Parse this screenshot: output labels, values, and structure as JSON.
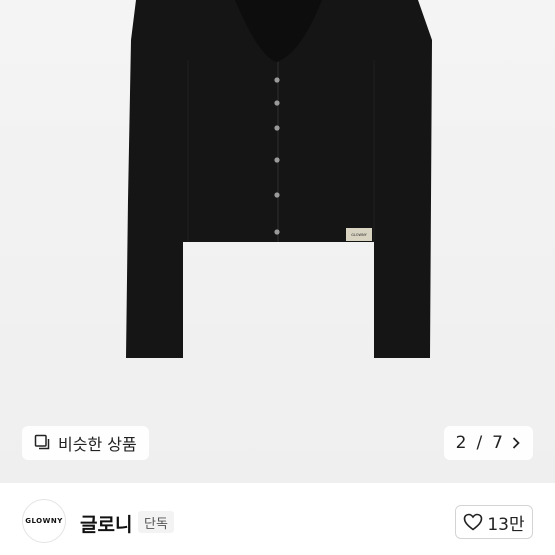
{
  "product": {
    "image_icon": "black-cardigan-product-image",
    "similar_button": {
      "label": "비슷한 상품",
      "icon": "similar-products-icon"
    },
    "pager": {
      "current": "2",
      "separator": "/",
      "total": "7",
      "icon": "chevron-right-icon"
    },
    "label_tag_text": "GLOWNY"
  },
  "brand": {
    "logo_text": "GLOWNY",
    "name": "글로니",
    "badge": "단독",
    "likes": {
      "count": "13만",
      "icon": "heart-outline-icon"
    }
  },
  "colors": {
    "image_background": "#f2f2f2",
    "garment": "#151515",
    "text": "#222222"
  }
}
